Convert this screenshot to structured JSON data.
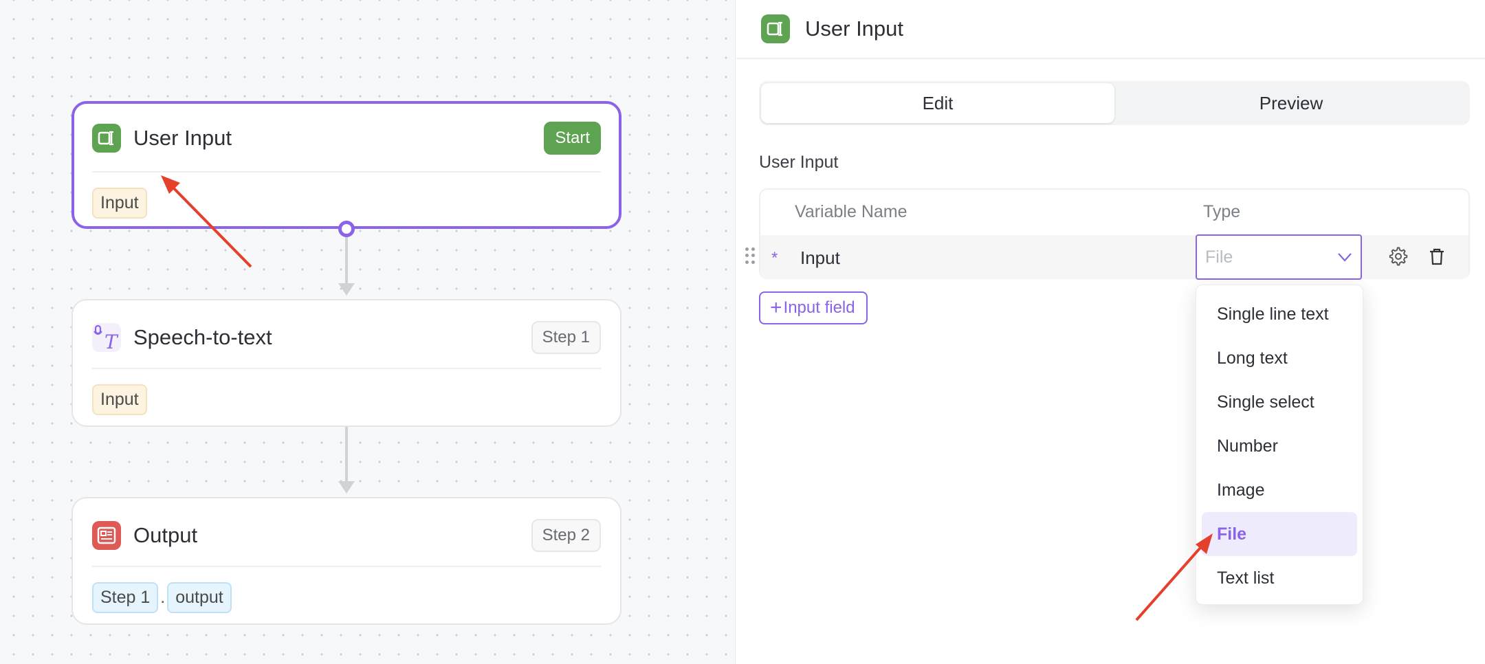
{
  "canvas": {
    "nodes": [
      {
        "title": "User Input",
        "badge": "Start",
        "chips": [
          "Input"
        ]
      },
      {
        "title": "Speech-to-text",
        "badge": "Step 1",
        "chips": [
          "Input"
        ]
      },
      {
        "title": "Output",
        "badge": "Step 2",
        "chips": [
          "Step 1",
          "output"
        ],
        "chip_separator": "."
      }
    ]
  },
  "panel": {
    "title": "User Input",
    "tabs": [
      {
        "label": "Edit",
        "active": true
      },
      {
        "label": "Preview",
        "active": false
      }
    ],
    "section_label": "User Input",
    "table": {
      "headers": {
        "variable_name": "Variable Name",
        "type": "Type"
      },
      "rows": [
        {
          "required_mark": "*",
          "name": "Input",
          "type": "File"
        }
      ]
    },
    "add_button": {
      "icon": "+",
      "label": "Input field"
    },
    "type_options": [
      {
        "label": "Single line text",
        "selected": false
      },
      {
        "label": "Long text",
        "selected": false
      },
      {
        "label": "Single select",
        "selected": false
      },
      {
        "label": "Number",
        "selected": false
      },
      {
        "label": "Image",
        "selected": false
      },
      {
        "label": "File",
        "selected": true
      },
      {
        "label": "Text list",
        "selected": false
      }
    ]
  },
  "colors": {
    "accent": "#8a63e8",
    "start_badge": "#5ea352",
    "input_chip_bg": "#fdf3e1",
    "output_chip_bg": "#e6f4fd",
    "annotation_arrow": "#e5402b"
  },
  "icons": {
    "user_input": "user-input-icon",
    "speech_to_text": "speech-to-text-icon",
    "output": "output-icon",
    "settings": "gear-icon",
    "delete": "trash-icon",
    "dropdown": "chevron-down-icon",
    "drag": "drag-handle-icon"
  }
}
